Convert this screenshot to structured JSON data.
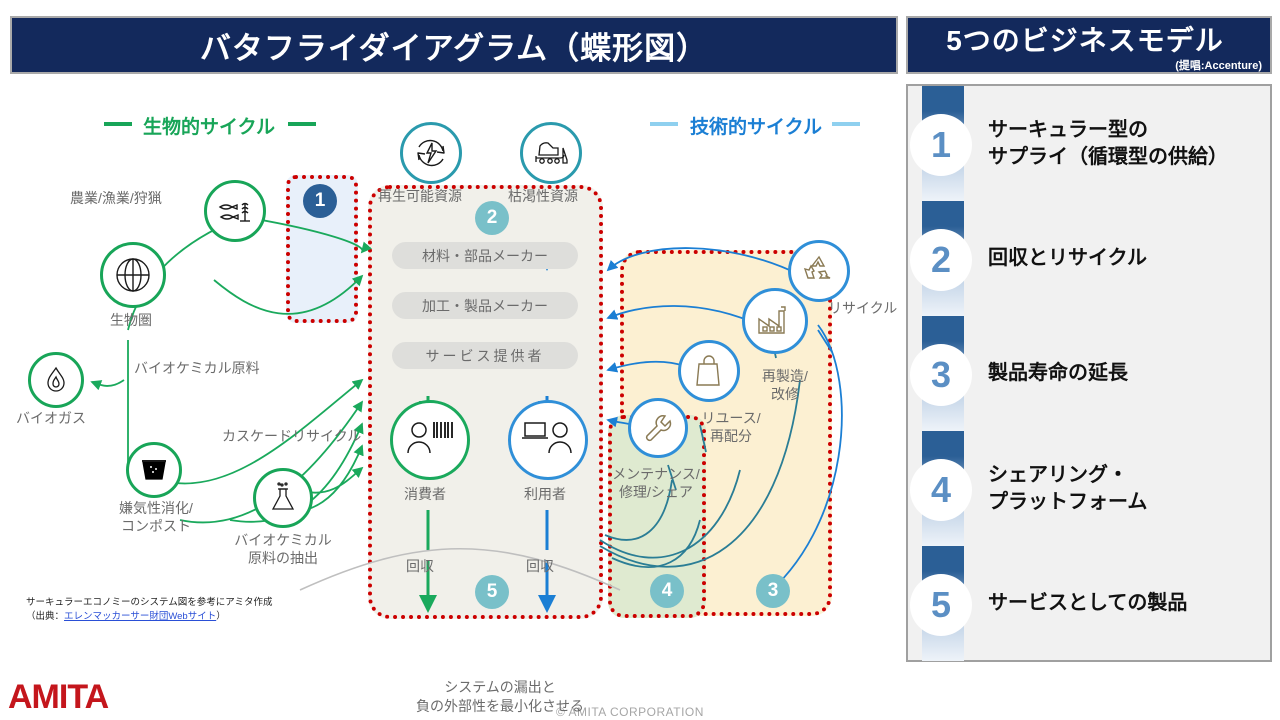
{
  "header": {
    "main_title": "バタフライダイアグラム（蝶形図）",
    "panel_title": "5つのビジネスモデル",
    "panel_subtitle": "(提唱:Accenture)"
  },
  "models": [
    {
      "number": "1",
      "label_line1": "サーキュラー型の",
      "label_line2": "サプライ（循環型の供給）"
    },
    {
      "number": "2",
      "label_line1": "回収とリサイクル",
      "label_line2": ""
    },
    {
      "number": "3",
      "label_line1": "製品寿命の延長",
      "label_line2": ""
    },
    {
      "number": "4",
      "label_line1": "シェアリング・",
      "label_line2": "プラットフォーム"
    },
    {
      "number": "5",
      "label_line1": "サービスとしての製品",
      "label_line2": ""
    }
  ],
  "diagram": {
    "bio_cycle_title": "生物的サイクル",
    "tech_cycle_title": "技術的サイクル",
    "badges": {
      "b1": "1",
      "b2": "2",
      "b3": "3",
      "b4": "4",
      "b5": "5"
    },
    "labels": {
      "agriculture": "農業/漁業/狩猟",
      "biosphere": "生物圏",
      "biogas": "バイオガス",
      "biochemical_feedstock": "バイオケミカル原料",
      "cascade_recycle": "カスケードリサイクル",
      "anaerobic_line1": "嫌気性消化/",
      "anaerobic_line2": "コンポスト",
      "extraction_line1": "バイオケミカル",
      "extraction_line2": "原料の抽出",
      "renewable_resource": "再生可能資源",
      "finite_resource": "枯渇性資源",
      "maker_materials": "材料・部品メーカー",
      "maker_products": "加工・製品メーカー",
      "service_provider": "サービス提供者",
      "consumer": "消費者",
      "user": "利用者",
      "collection_left": "回収",
      "collection_right": "回収",
      "recycle": "リサイクル",
      "remanufacture_line1": "再製造/",
      "remanufacture_line2": "改修",
      "reuse_line1": "リユース/",
      "reuse_line2": "再配分",
      "maintenance_line1": "メンテナンス/",
      "maintenance_line2": "修理/シェア",
      "funnel_line1": "システムの漏出と",
      "funnel_line2": "負の外部性を最小化させる"
    },
    "source_note_line1": "サーキュラーエコノミーのシステム図を参考にアミタ作成",
    "source_note_prefix": "（出典：",
    "source_note_link": "エレンマッカーサー財団Webサイト",
    "source_note_suffix": "）"
  },
  "footer": {
    "logo": "AMITA",
    "copyright": "© AMITA CORPORATION"
  },
  "colors": {
    "navy": "#13295c",
    "green": "#18a558",
    "blue": "#1b7fd4",
    "teal": "#79c0c9",
    "red_dotted": "#cc0000",
    "brand_red": "#c4161c"
  }
}
